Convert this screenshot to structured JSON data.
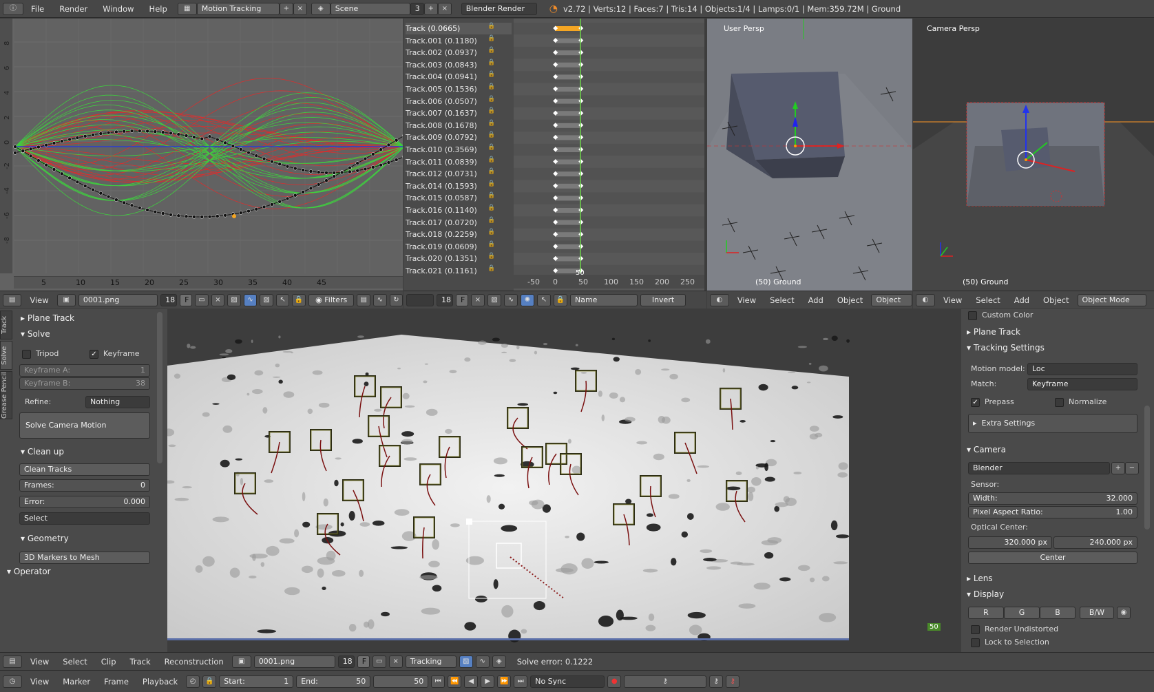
{
  "topbar": {
    "menus": [
      "File",
      "Render",
      "Window",
      "Help"
    ],
    "screen_layout": "Motion Tracking",
    "scene": "Scene",
    "scene_count": "3",
    "engine": "Blender Render",
    "stats": "v2.72 | Verts:12 | Faces:7 | Tris:14 | Objects:1/4 | Lamps:0/1 | Mem:359.72M | Ground"
  },
  "graph": {
    "y_ticks": [
      "8",
      "6",
      "4",
      "2",
      "0",
      "-2",
      "-4",
      "-6",
      "-8"
    ],
    "x_ticks": [
      "5",
      "10",
      "15",
      "20",
      "25",
      "30",
      "35",
      "40",
      "45"
    ],
    "header": {
      "view": "View",
      "clip": "0001.png",
      "num": "18",
      "f": "F",
      "filters": "Filters"
    }
  },
  "tracks": {
    "items": [
      "Track (0.0665)",
      "Track.001 (0.1180)",
      "Track.002 (0.0937)",
      "Track.003 (0.0843)",
      "Track.004 (0.0941)",
      "Track.005 (0.1536)",
      "Track.006 (0.0507)",
      "Track.007 (0.1637)",
      "Track.008 (0.1678)",
      "Track.009 (0.0792)",
      "Track.010 (0.3569)",
      "Track.011 (0.0839)",
      "Track.012 (0.0731)",
      "Track.014 (0.1593)",
      "Track.015 (0.0587)",
      "Track.016 (0.1140)",
      "Track.017 (0.0720)",
      "Track.018 (0.2259)",
      "Track.019 (0.0609)",
      "Track.020 (0.1351)",
      "Track.021 (0.1161)"
    ]
  },
  "dope": {
    "x_ticks": [
      "-50",
      "0",
      "50",
      "100",
      "150",
      "200",
      "250"
    ],
    "frame_marker": "50",
    "header": {
      "num": "18",
      "f": "F",
      "name": "Name",
      "invert": "Invert"
    }
  },
  "vp1": {
    "label": "User Persp",
    "footer": "(50) Ground",
    "header": {
      "menus": [
        "View",
        "Select",
        "Add",
        "Object"
      ],
      "mode": "Object M"
    }
  },
  "vp2": {
    "label": "Camera Persp",
    "footer": "(50) Ground",
    "header": {
      "menus": [
        "View",
        "Select",
        "Add",
        "Object"
      ],
      "mode": "Object Mode"
    }
  },
  "left": {
    "tabs": [
      "Track",
      "Solve",
      "Grease Pencil"
    ],
    "plane_track": "Plane Track",
    "solve": "Solve",
    "tripod": "Tripod",
    "keyframe": "Keyframe",
    "keyframe_a_label": "Keyframe A:",
    "keyframe_a": "1",
    "keyframe_b_label": "Keyframe B:",
    "keyframe_b": "38",
    "refine_label": "Refine:",
    "refine": "Nothing",
    "solve_btn": "Solve Camera Motion",
    "cleanup": "Clean up",
    "clean_tracks": "Clean Tracks",
    "frames_label": "Frames:",
    "frames": "0",
    "error_label": "Error:",
    "error": "0.000",
    "select": "Select",
    "geometry": "Geometry",
    "markers_to_mesh": "3D Markers to Mesh",
    "operator": "Operator"
  },
  "right": {
    "custom_color": "Custom Color",
    "plane_track": "Plane Track",
    "tracking_settings": "Tracking Settings",
    "motion_model_label": "Motion model:",
    "motion_model": "Loc",
    "match_label": "Match:",
    "match": "Keyframe",
    "prepass": "Prepass",
    "normalize": "Normalize",
    "extra_settings": "Extra Settings",
    "camera": "Camera",
    "camera_preset": "Blender",
    "sensor": "Sensor:",
    "width_label": "Width:",
    "width": "32.000",
    "par_label": "Pixel Aspect Ratio:",
    "par": "1.00",
    "optical_center": "Optical Center:",
    "oc_x": "320.000 px",
    "oc_y": "240.000 px",
    "center": "Center",
    "lens": "Lens",
    "display": "Display",
    "r": "R",
    "g": "G",
    "b": "B",
    "bw": "B/W",
    "render_undistorted": "Render Undistorted",
    "lock_to_selection": "Lock to Selection"
  },
  "clip": {
    "frame": "50"
  },
  "clip_header": {
    "menus": [
      "View",
      "Select",
      "Clip",
      "Track",
      "Reconstruction"
    ],
    "clip": "0001.png",
    "num": "18",
    "f": "F",
    "mode": "Tracking",
    "solve_error": "Solve error: 0.1222"
  },
  "timeline": {
    "menus": [
      "View",
      "Marker",
      "Frame",
      "Playback"
    ],
    "start_label": "Start:",
    "start": "1",
    "end_label": "End:",
    "end": "50",
    "current": "50",
    "sync": "No Sync"
  },
  "colors": {
    "accent": "#f5a623",
    "x_curve": "#d63030",
    "y_curve": "#3fcf3f",
    "marker": "#2b2b14"
  }
}
